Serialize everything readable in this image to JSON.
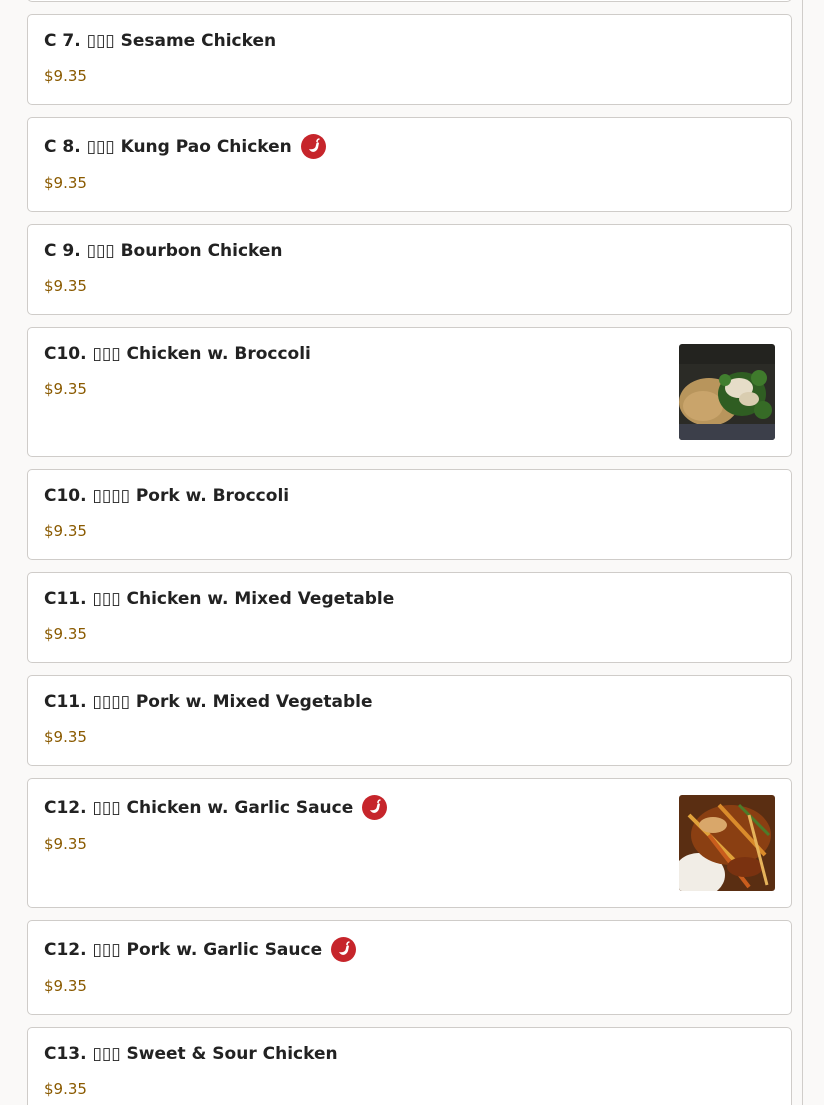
{
  "menu": {
    "items": [
      {
        "name": "C 7. ▯▯▯ Sesame Chicken",
        "price": "$9.35",
        "spicy": false,
        "image": null
      },
      {
        "name": "C 8. ▯▯▯ Kung Pao Chicken",
        "price": "$9.35",
        "spicy": true,
        "image": null
      },
      {
        "name": "C 9. ▯▯▯ Bourbon Chicken",
        "price": "$9.35",
        "spicy": false,
        "image": null
      },
      {
        "name": "C10. ▯▯▯ Chicken w. Broccoli",
        "price": "$9.35",
        "spicy": false,
        "image": "chicken-broccoli-photo"
      },
      {
        "name": "C10. ▯▯▯▯ Pork w. Broccoli",
        "price": "$9.35",
        "spicy": false,
        "image": null
      },
      {
        "name": "C11. ▯▯▯ Chicken w. Mixed Vegetable",
        "price": "$9.35",
        "spicy": false,
        "image": null
      },
      {
        "name": "C11. ▯▯▯▯ Pork w. Mixed Vegetable",
        "price": "$9.35",
        "spicy": false,
        "image": null
      },
      {
        "name": "C12. ▯▯▯ Chicken w. Garlic Sauce",
        "price": "$9.35",
        "spicy": true,
        "image": "garlic-sauce-photo"
      },
      {
        "name": "C12. ▯▯▯ Pork w. Garlic Sauce",
        "price": "$9.35",
        "spicy": true,
        "image": null
      },
      {
        "name": "C13. ▯▯▯ Sweet & Sour Chicken",
        "price": "$9.35",
        "spicy": false,
        "image": null
      }
    ]
  },
  "colors": {
    "price": "#8a5a00",
    "spicy_badge": "#c6252b",
    "card_border": "#cfccc9",
    "page_background": "#faf9f8"
  }
}
